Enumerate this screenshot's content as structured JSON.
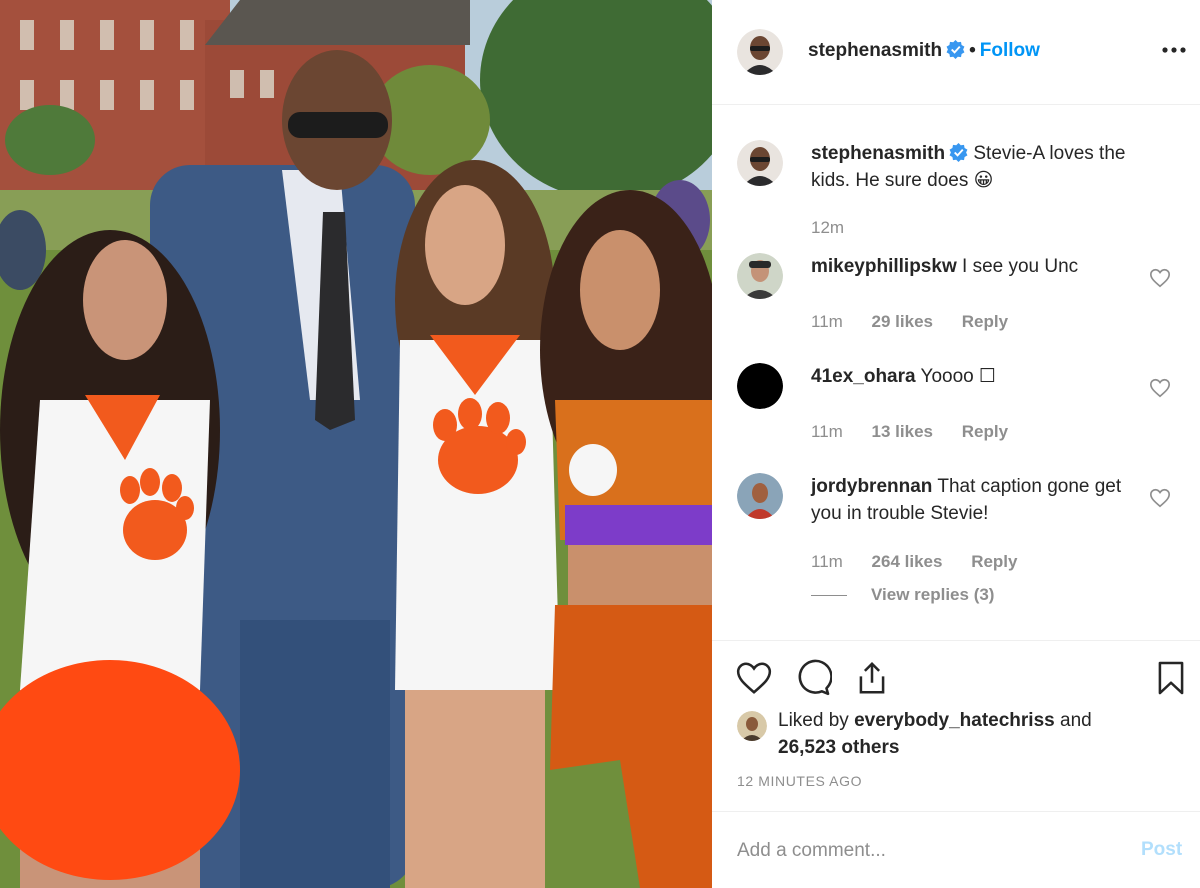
{
  "post": {
    "author": "stephenasmith",
    "follow_label": "Follow",
    "separator": "•",
    "more_icon": "more-horizontal-icon"
  },
  "caption": {
    "username": "stephenasmith",
    "text": "Stevie-A loves the kids. He sure does 😀",
    "time": "12m"
  },
  "comments": [
    {
      "username": "mikeyphillipskw",
      "text": "I see you Unc",
      "time": "11m",
      "likes": "29 likes",
      "reply": "Reply"
    },
    {
      "username": "41ex_ohara",
      "text": "Yoooo ☐",
      "time": "11m",
      "likes": "13 likes",
      "reply": "Reply"
    },
    {
      "username": "jordybrennan",
      "text": "That caption gone get you in trouble Stevie!",
      "time": "11m",
      "likes": "264 likes",
      "reply": "Reply",
      "view_replies": "View replies (3)"
    }
  ],
  "likes": {
    "prefix": "Liked by",
    "user": "everybody_hatechriss",
    "and": "and",
    "others": "26,523 others"
  },
  "timestamp": "12 MINUTES AGO",
  "add_comment": {
    "placeholder": "Add a comment...",
    "post_label": "Post"
  },
  "colors": {
    "accent": "#0095f6",
    "post_disabled": "#b2dffc",
    "muted": "#8e8e8e",
    "verified": "#3897f0"
  }
}
